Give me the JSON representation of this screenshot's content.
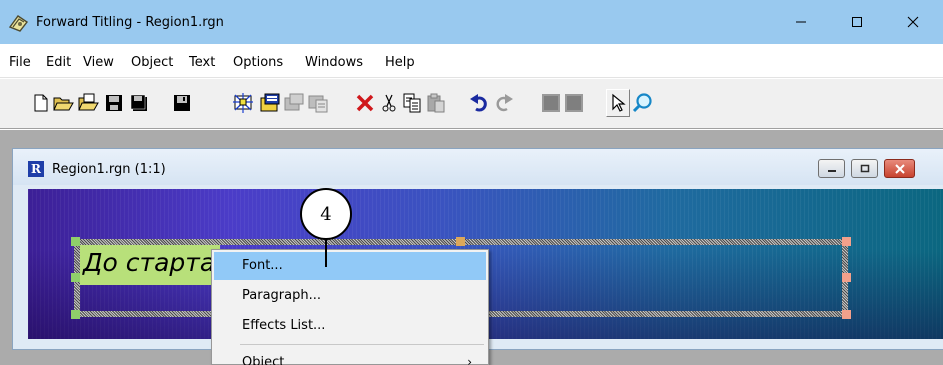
{
  "window": {
    "title": "Forward Titling - Region1.rgn"
  },
  "menu": [
    "File",
    "Edit",
    "View",
    "Object",
    "Text",
    "Options",
    "Windows",
    "Help"
  ],
  "toolbar_buttons": [
    "new-icon",
    "open-icon",
    "open-file-icon",
    "save-icon",
    "save-all-icon",
    "save-floppy-icon",
    "region-effect-icon",
    "import-icon",
    "insert-layer-icon",
    "insert-text-layer-icon",
    "delete-icon",
    "cut-icon",
    "copy-icon",
    "paste-icon",
    "undo-icon",
    "redo-icon",
    "layer-left-icon",
    "layer-right-icon",
    "pointer-icon",
    "zoom-icon"
  ],
  "child": {
    "title": "Region1.rgn  (1:1)",
    "icon_letter": "R"
  },
  "canvas": {
    "text": "До старта"
  },
  "context_menu": {
    "items": [
      {
        "label": "Font...",
        "highlighted": true
      },
      {
        "label": "Paragraph...",
        "highlighted": false
      },
      {
        "label": "Effects List...",
        "highlighted": false
      },
      {
        "label": "Object",
        "submenu": true
      }
    ]
  },
  "callout": {
    "number": "4"
  },
  "colors": {
    "titlebar": "#99c9ef",
    "toolbar": "#f0f0f0",
    "workspace": "#ababab",
    "menu_highlight": "#91c9f7",
    "text_highlight": "#b8e07a"
  }
}
